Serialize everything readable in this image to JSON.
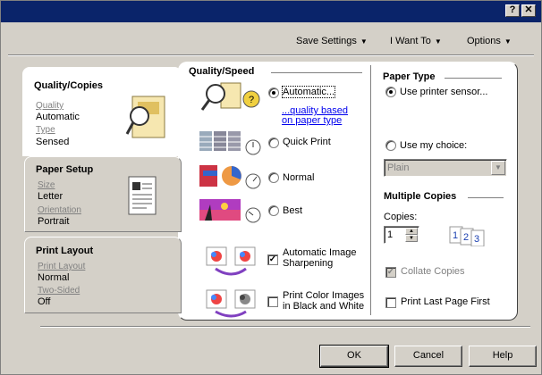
{
  "titlebar": {
    "help": "?",
    "close": "✕"
  },
  "menus": [
    {
      "label": "Save Settings"
    },
    {
      "label": "I Want To"
    },
    {
      "label": "Options"
    }
  ],
  "tabs": {
    "quality": {
      "title": "Quality/Copies",
      "quality_label": "Quality",
      "quality_value": "Automatic",
      "type_label": "Type",
      "type_value": "Sensed"
    },
    "paper": {
      "title": "Paper Setup",
      "size_label": "Size",
      "size_value": "Letter",
      "orientation_label": "Orientation",
      "orientation_value": "Portrait"
    },
    "layout": {
      "title": "Print Layout",
      "layout_label": "Print Layout",
      "layout_value": "Normal",
      "twosided_label": "Two-Sided",
      "twosided_value": "Off"
    }
  },
  "quality_speed": {
    "title": "Quality/Speed",
    "options": [
      {
        "label": "Automatic...",
        "selected": true
      },
      {
        "label": "Quick Print",
        "selected": false
      },
      {
        "label": "Normal",
        "selected": false
      },
      {
        "label": "Best",
        "selected": false
      }
    ],
    "link_line1": "...quality based",
    "link_line2": "on paper type",
    "sharpen_line1": "Automatic Image",
    "sharpen_line2": "Sharpening",
    "sharpen_checked": true,
    "bw_line1": "Print Color Images",
    "bw_line2": "in Black and White",
    "bw_checked": false
  },
  "paper_type": {
    "title": "Paper Type",
    "sensor_label": "Use printer sensor...",
    "sensor_selected": true,
    "choice_label": "Use my choice:",
    "choice_selected": false,
    "dropdown_value": "Plain"
  },
  "copies": {
    "title": "Multiple Copies",
    "copies_label": "Copies:",
    "copies_value": "1",
    "collate_label": "Collate Copies",
    "collate_checked": true,
    "last_first_label": "Print Last Page First",
    "last_first_checked": false,
    "collate_icon_digits": "1 2 3"
  },
  "buttons": {
    "ok": "OK",
    "cancel": "Cancel",
    "help": "Help"
  },
  "colors": {
    "titlebar": "#0a246a",
    "face": "#d4d0c8",
    "link": "#0000ee"
  }
}
